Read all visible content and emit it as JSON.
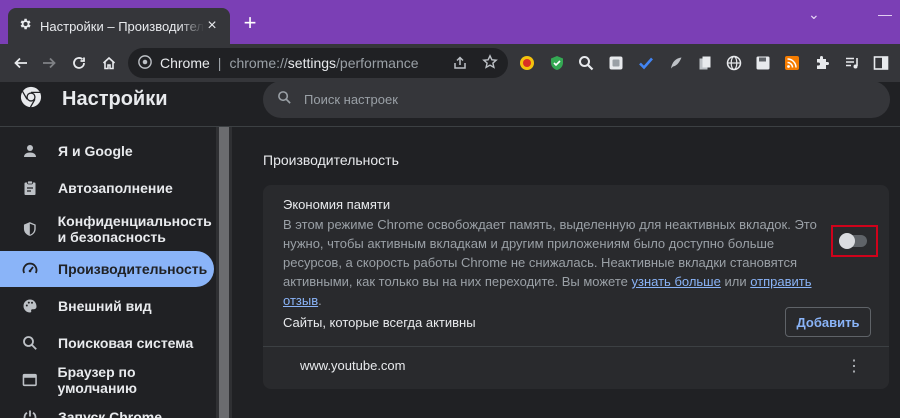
{
  "colors": {
    "titlebar": "#7b3fb5",
    "background": "#202124",
    "card": "#292a2d",
    "accent": "#8ab4f8",
    "highlight_frame": "#d0021b"
  },
  "tab": {
    "title": "Настройки – Производительность",
    "icon": "gear-icon"
  },
  "toolbar": {
    "site_name": "Chrome",
    "url_prefix": "chrome://",
    "url_host": "settings",
    "url_path": "/performance"
  },
  "settings": {
    "title": "Настройки",
    "search_placeholder": "Поиск настроек"
  },
  "sidebar": {
    "items": [
      {
        "label": "Я и Google",
        "icon": "person-icon"
      },
      {
        "label": "Автозаполнение",
        "icon": "clipboard-icon"
      },
      {
        "label": "Конфиденциальность и безопасность",
        "icon": "shield-icon"
      },
      {
        "label": "Производительность",
        "icon": "speedometer-icon",
        "active": true
      },
      {
        "label": "Внешний вид",
        "icon": "palette-icon"
      },
      {
        "label": "Поисковая система",
        "icon": "search-icon"
      },
      {
        "label": "Браузер по умолчанию",
        "icon": "browser-icon"
      },
      {
        "label": "Запуск Chrome",
        "icon": "power-icon"
      }
    ]
  },
  "main": {
    "heading": "Производительность",
    "memory_saver": {
      "title": "Экономия памяти",
      "description": "В этом режиме Chrome освобождает память, выделенную для неактивных вкладок. Это нужно, чтобы активным вкладкам и другим приложениям было доступно больше ресурсов, а скорость работы Chrome не снижалась. Неактивные вкладки становятся активными, как только вы на них переходите. Вы можете",
      "learn_more": "узнать больше",
      "or": "или",
      "feedback": "отправить отзыв",
      "period": ".",
      "enabled": false
    },
    "always_active": {
      "title": "Сайты, которые всегда активны",
      "add_label": "Добавить",
      "sites": [
        "www.youtube.com"
      ]
    }
  }
}
